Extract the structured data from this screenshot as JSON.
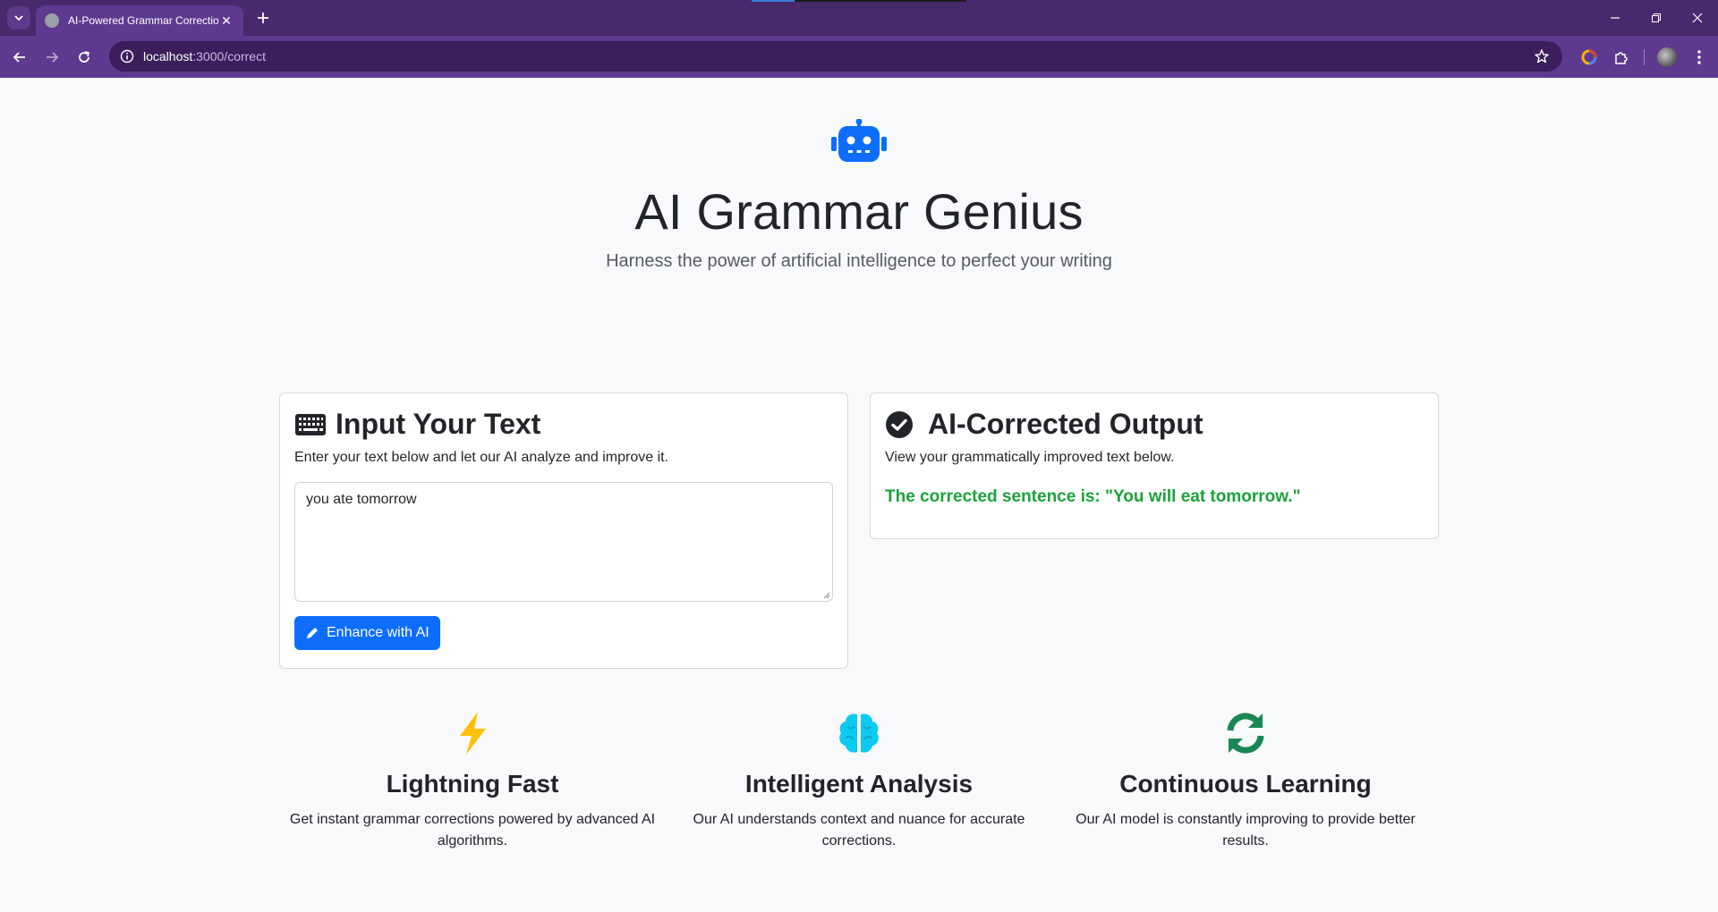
{
  "browser": {
    "tab_title": "AI-Powered Grammar Correction",
    "url_host": "localhost",
    "url_rest": ":3000/correct"
  },
  "hero": {
    "title": "AI Grammar Genius",
    "subtitle": "Harness the power of artificial intelligence to perfect your writing"
  },
  "input_card": {
    "heading": "Input Your Text",
    "description": "Enter your text below and let our AI analyze and improve it.",
    "textarea_value": "you ate tomorrow",
    "button_label": "Enhance with AI"
  },
  "output_card": {
    "heading": "AI-Corrected Output",
    "description": "View your grammatically improved text below.",
    "result": "The corrected sentence is: \"You will eat tomorrow.\""
  },
  "features": [
    {
      "icon": "lightning-icon",
      "title": "Lightning Fast",
      "description": "Get instant grammar corrections powered by advanced AI algorithms."
    },
    {
      "icon": "brain-icon",
      "title": "Intelligent Analysis",
      "description": "Our AI understands context and nuance for accurate corrections."
    },
    {
      "icon": "sync-icon",
      "title": "Continuous Learning",
      "description": "Our AI model is constantly improving to provide better results."
    }
  ],
  "colors": {
    "primary": "#0d6efd",
    "success": "#19a339",
    "warning": "#ffc107",
    "info": "#0dcaf0",
    "green": "#198754",
    "chrome": "#5d3a8f"
  }
}
